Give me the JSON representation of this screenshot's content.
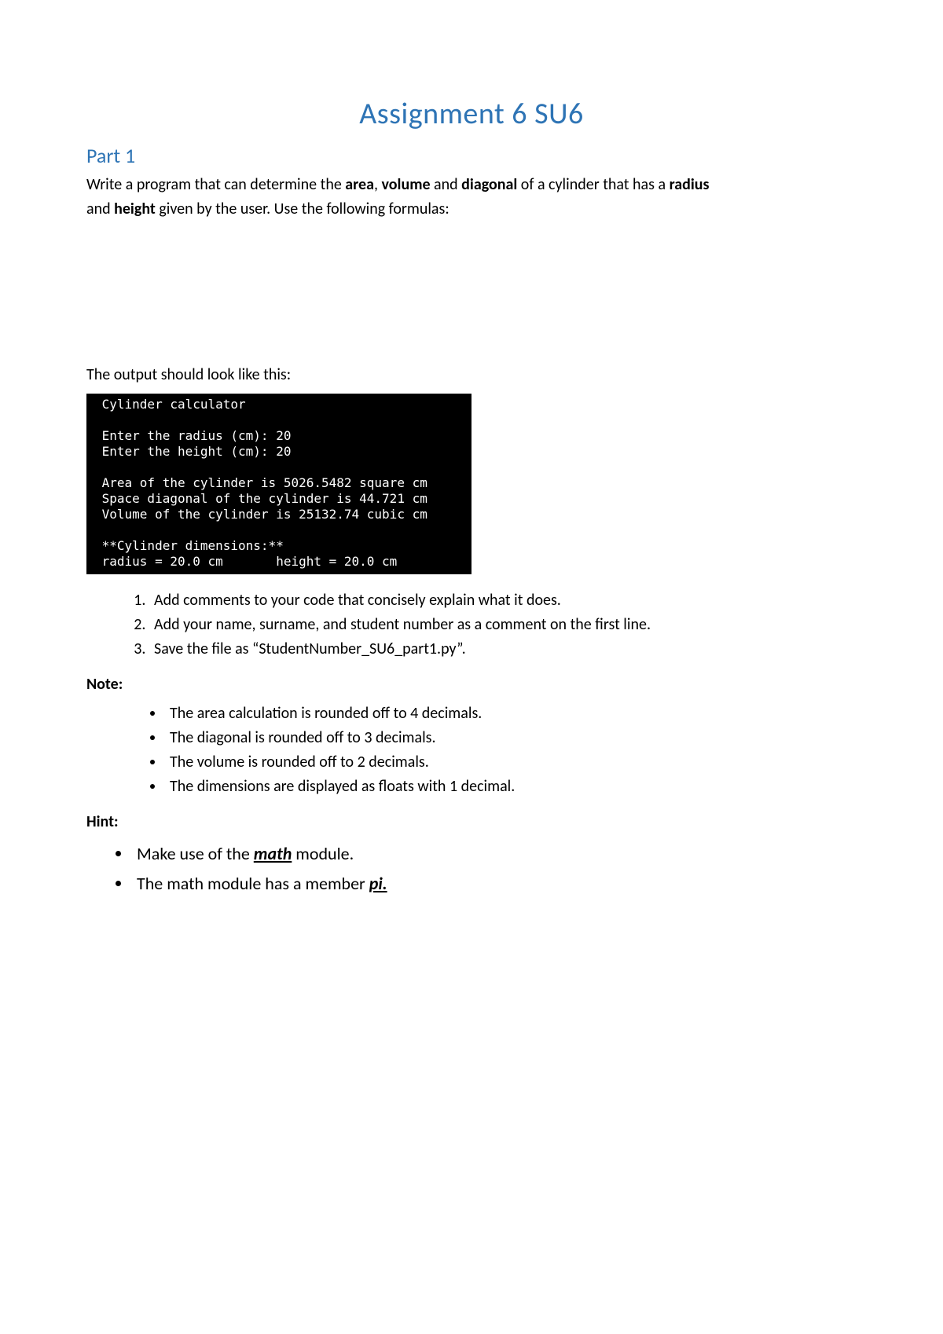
{
  "title": "Assignment 6 SU6",
  "part_heading": "Part 1",
  "intro": {
    "pre1": "Write a program that can determine the ",
    "b1": "area",
    "sep1": ", ",
    "b2": "volume",
    "mid1": " and ",
    "b3": "diagonal",
    "mid2": " of a cylinder that has a ",
    "b4": "radius",
    "line2a": "and ",
    "b5": "height",
    "line2b": " given by the user. Use the following formulas:"
  },
  "output_label": "The output should look like this:",
  "console": " Cylinder calculator\n\n Enter the radius (cm): 20\n Enter the height (cm): 20\n\n Area of the cylinder is 5026.5482 square cm\n Space diagonal of the cylinder is 44.721 cm\n Volume of the cylinder is 25132.74 cubic cm\n\n **Cylinder dimensions:**\n radius = 20.0 cm       height = 20.0 cm",
  "steps": [
    "Add comments to your code that concisely explain what it does.",
    "Add your name, surname, and student number as a comment on the first line.",
    "Save the file as “StudentNumber_SU6_part1.py”."
  ],
  "note_label": "Note",
  "note_colon": ":",
  "notes": [
    "The area calculation is rounded off to 4 decimals.",
    "The diagonal is rounded off to 3 decimals.",
    "The volume is rounded off to 2 decimals.",
    "The dimensions are displayed as floats with 1 decimal."
  ],
  "hint_label": "Hint:",
  "hints": {
    "h1a": "Make use of the ",
    "h1b": "math",
    "h1c": " module.",
    "h2a": "The math module has a member ",
    "h2b": "pi.",
    "h2c": ""
  }
}
